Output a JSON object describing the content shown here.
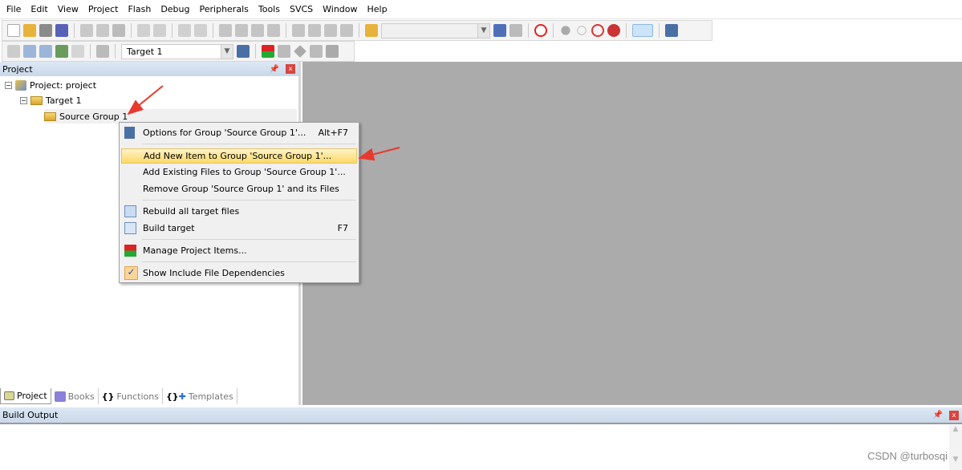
{
  "menubar": [
    "File",
    "Edit",
    "View",
    "Project",
    "Flash",
    "Debug",
    "Peripherals",
    "Tools",
    "SVCS",
    "Window",
    "Help"
  ],
  "toolbar": {
    "target_select": "Target 1",
    "find_combo": ""
  },
  "project_panel": {
    "title": "Project",
    "tree": {
      "root": "Project: project",
      "target": "Target 1",
      "group": "Source Group 1"
    },
    "tabs": [
      "Project",
      "Books",
      "Functions",
      "Templates"
    ]
  },
  "context_menu": [
    {
      "label": "Options for Group 'Source Group 1'...",
      "shortcut": "Alt+F7",
      "icon": "options-wand-icon"
    },
    {
      "label": "Add New  Item to Group 'Source Group 1'...",
      "shortcut": "",
      "highlighted": true
    },
    {
      "label": "Add Existing Files to Group 'Source Group 1'...",
      "shortcut": ""
    },
    {
      "label": "Remove Group 'Source Group 1' and its Files",
      "shortcut": ""
    },
    {
      "label": "Rebuild all target files",
      "shortcut": "",
      "icon": "rebuild-icon"
    },
    {
      "label": "Build target",
      "shortcut": "F7",
      "icon": "build-icon"
    },
    {
      "label": "Manage Project Items...",
      "shortcut": "",
      "icon": "manage-items-icon"
    },
    {
      "label": "Show Include File Dependencies",
      "shortcut": "",
      "icon": "checkmark-icon",
      "checked": true
    }
  ],
  "build_output": {
    "title": "Build Output"
  },
  "watermark": "CSDN @turbosqi",
  "colors": {
    "highlight": "#fbd867",
    "workspace": "#ababab",
    "annotation_arrow": "#e8392f"
  }
}
